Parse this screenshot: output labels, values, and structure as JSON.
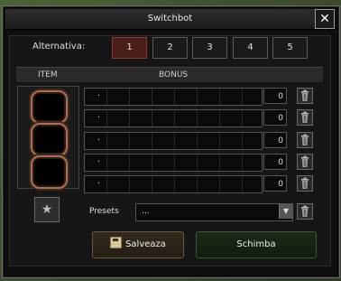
{
  "window": {
    "title": "Switchbot",
    "close_glyph": "✕"
  },
  "alternatives": {
    "label": "Alternativa:",
    "tabs": [
      "1",
      "2",
      "3",
      "4",
      "5"
    ],
    "active_index": 0
  },
  "columns": {
    "item": "ITEM",
    "bonus": "BONUS"
  },
  "bonus_rows": [
    {
      "name": ".",
      "value": "0"
    },
    {
      "name": ".",
      "value": "0"
    },
    {
      "name": ".",
      "value": "0"
    },
    {
      "name": ".",
      "value": "0"
    },
    {
      "name": ".",
      "value": "0"
    }
  ],
  "presets": {
    "label": "Presets",
    "value": "..."
  },
  "buttons": {
    "save": "Salveaza",
    "change": "Schimba"
  },
  "icons": {
    "close": "close-icon",
    "trash": "trash-icon",
    "dropdown": "chevron-down-icon",
    "save": "floppy-disk-icon",
    "item_slot": "star-icon"
  },
  "colors": {
    "active_tab": "#4a1e18",
    "socket_ring": "#b07050",
    "save_button": "#2c2419",
    "change_button": "#1c2a18"
  }
}
